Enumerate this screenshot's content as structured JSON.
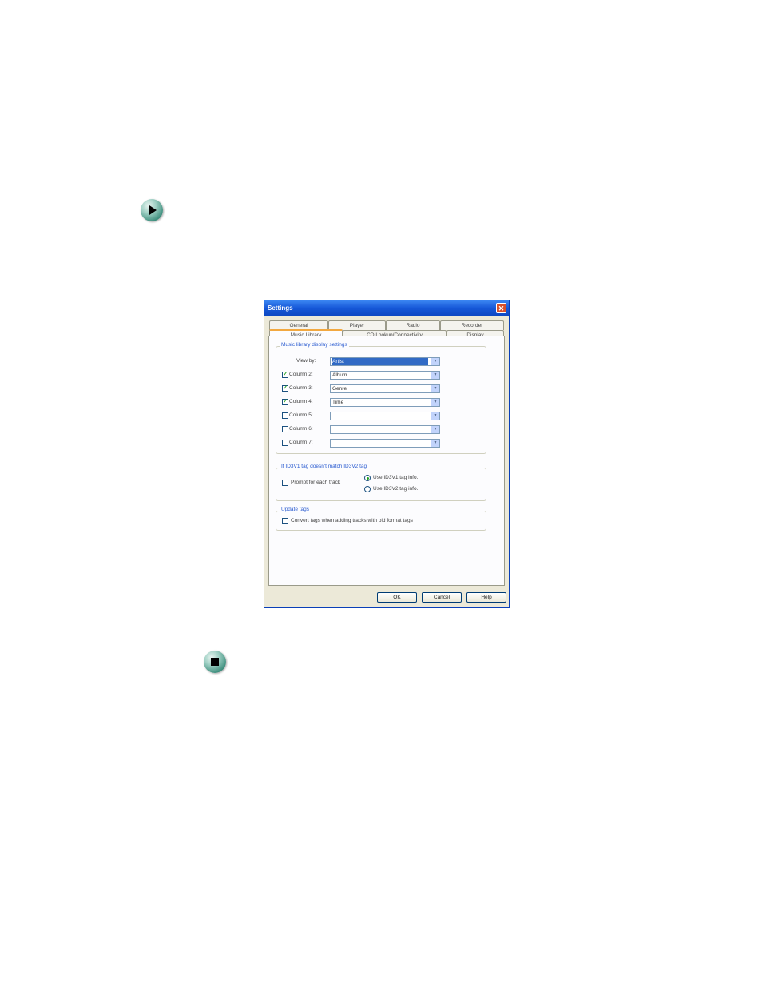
{
  "dialog": {
    "title": "Settings",
    "close_icon": "close-icon",
    "tabs_row1": [
      "General",
      "Player",
      "Radio",
      "Recorder"
    ],
    "tabs_row2": [
      "Music Library",
      "CD Lookup/Connectivity",
      "Display"
    ],
    "active_tab": "Music Library",
    "display_group": {
      "label": "Music library display settings",
      "view_by_label": "View by:",
      "view_by_value": "Artist",
      "columns": [
        {
          "label": "Column 2:",
          "checked": true,
          "value": "Album"
        },
        {
          "label": "Column 3:",
          "checked": true,
          "value": "Genre"
        },
        {
          "label": "Column 4:",
          "checked": true,
          "value": "Time"
        },
        {
          "label": "Column 5:",
          "checked": false,
          "value": ""
        },
        {
          "label": "Column 6:",
          "checked": false,
          "value": ""
        },
        {
          "label": "Column 7:",
          "checked": false,
          "value": ""
        }
      ]
    },
    "id3_group": {
      "label": "If ID3V1 tag doesn't match ID3V2 tag",
      "prompt_label": "Prompt for each track",
      "prompt_checked": false,
      "radio1_label": "Use ID3V1 tag info.",
      "radio1_selected": true,
      "radio2_label": "Use ID3V2 tag info.",
      "radio2_selected": false
    },
    "update_group": {
      "label": "Update tags",
      "convert_label": "Convert tags when adding tracks with old format tags",
      "convert_checked": false
    },
    "buttons": {
      "ok": "OK",
      "cancel": "Cancel",
      "help": "Help"
    }
  },
  "icons": {
    "start": "arrow-right-icon",
    "end": "stop-square-icon"
  }
}
